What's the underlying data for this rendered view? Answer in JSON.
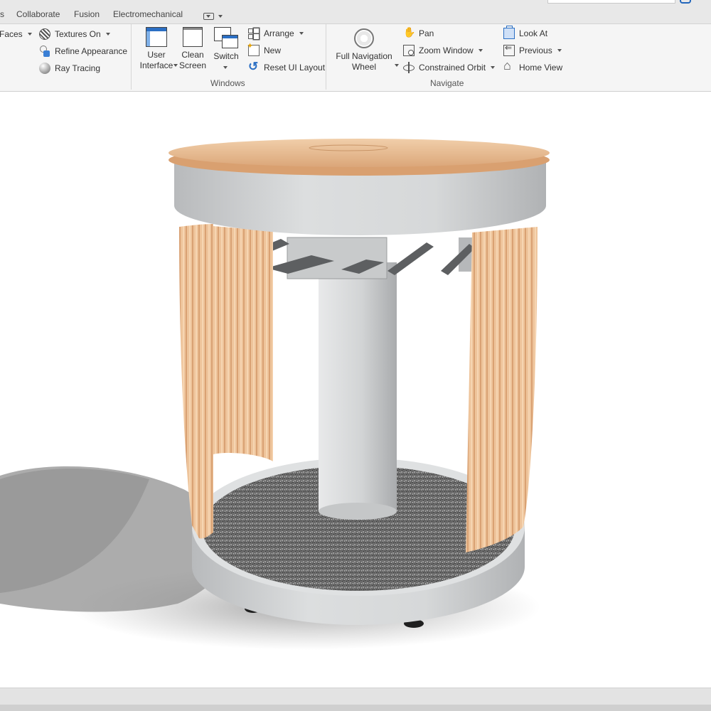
{
  "ribbon_tabs": {
    "partial_left": "s",
    "collaborate": "Collaborate",
    "fusion": "Fusion",
    "electromechanical": "Electromechanical"
  },
  "appearance": {
    "faces_label": "Faces",
    "textures_label": "Textures On",
    "refine_label": "Refine Appearance",
    "ray_label": "Ray Tracing"
  },
  "windows": {
    "user_interface_line1": "User",
    "user_interface_line2": "Interface",
    "clean_line1": "Clean",
    "clean_line2": "Screen",
    "switch_label": "Switch",
    "arrange_label": "Arrange",
    "new_label": "New",
    "reset_label": "Reset UI Layout",
    "panel_title": "Windows"
  },
  "navigate": {
    "wheel_line1": "Full Navigation",
    "wheel_line2": "Wheel",
    "pan_label": "Pan",
    "zoom_label": "Zoom Window",
    "orbit_label": "Constrained Orbit",
    "lookat_label": "Look At",
    "previous_label": "Previous",
    "home_label": "Home View",
    "panel_title": "Navigate"
  },
  "icons": [
    "search-icon",
    "textures-icon",
    "refine-appearance-icon",
    "ray-tracing-icon",
    "user-interface-icon",
    "clean-screen-icon",
    "switch-icon",
    "arrange-icon",
    "new-window-icon",
    "reset-layout-icon",
    "navigation-wheel-icon",
    "pan-icon",
    "zoom-window-icon",
    "constrained-orbit-icon",
    "look-at-icon",
    "previous-view-icon",
    "home-view-icon"
  ],
  "colors": {
    "accent": "#2b6fc4",
    "ribbon_bg": "#f5f5f5",
    "wood": "#e9b88c",
    "shell": "#d0d2d4"
  }
}
